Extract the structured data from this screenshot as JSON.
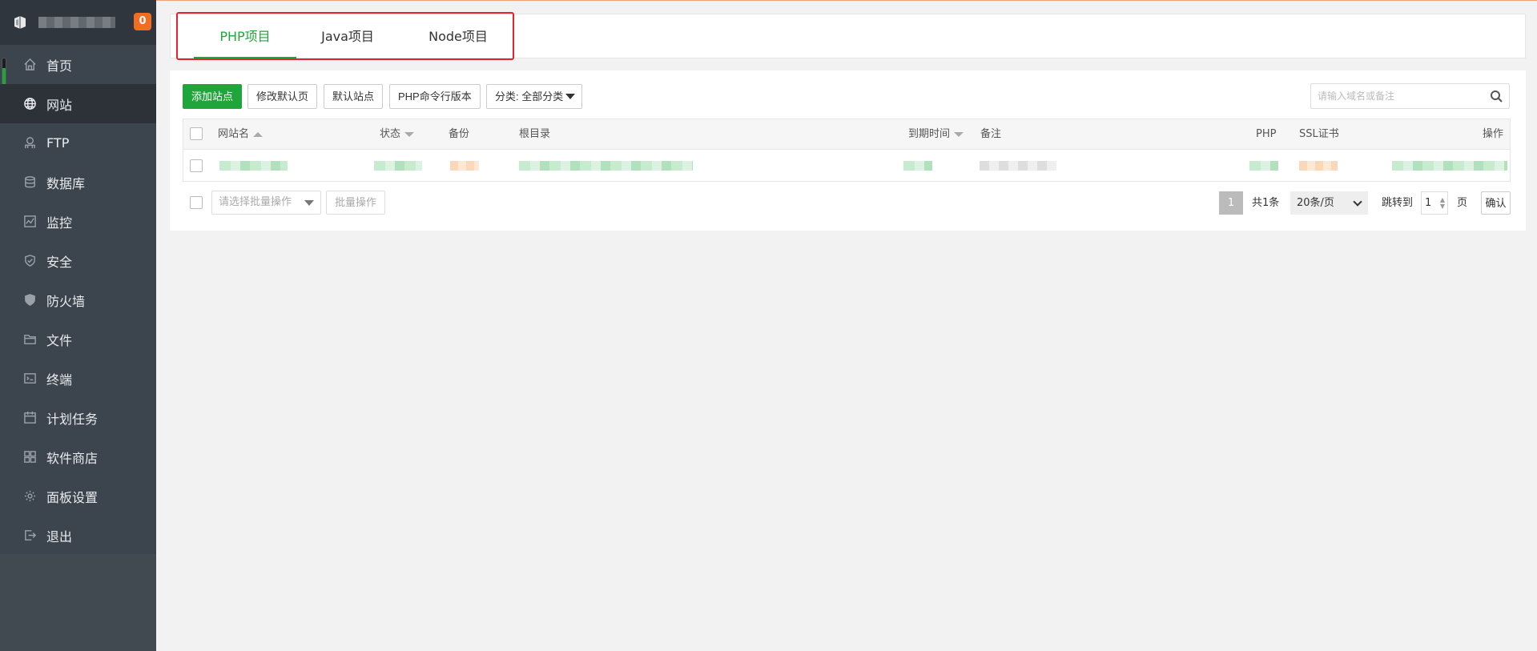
{
  "sidebar": {
    "badge": "0",
    "items": [
      {
        "label": "首页",
        "icon": "home-icon"
      },
      {
        "label": "网站",
        "icon": "globe-icon",
        "active": true
      },
      {
        "label": "FTP",
        "icon": "ftp-icon"
      },
      {
        "label": "数据库",
        "icon": "database-icon"
      },
      {
        "label": "监控",
        "icon": "monitor-icon"
      },
      {
        "label": "安全",
        "icon": "shield-icon"
      },
      {
        "label": "防火墙",
        "icon": "firewall-icon"
      },
      {
        "label": "文件",
        "icon": "folder-icon"
      },
      {
        "label": "终端",
        "icon": "terminal-icon"
      },
      {
        "label": "计划任务",
        "icon": "calendar-icon"
      },
      {
        "label": "软件商店",
        "icon": "apps-icon"
      },
      {
        "label": "面板设置",
        "icon": "gear-icon"
      },
      {
        "label": "退出",
        "icon": "logout-icon"
      }
    ]
  },
  "tabs": [
    {
      "label": "PHP项目",
      "active": true
    },
    {
      "label": "Java项目"
    },
    {
      "label": "Node项目"
    }
  ],
  "toolbar": {
    "add_site": "添加站点",
    "modify_default_page": "修改默认页",
    "default_site": "默认站点",
    "php_cli_version": "PHP命令行版本",
    "category": "分类: 全部分类"
  },
  "search": {
    "placeholder": "请输入域名或备注"
  },
  "table": {
    "columns": {
      "site_name": "网站名",
      "status": "状态",
      "backup": "备份",
      "root_dir": "根目录",
      "expire_time": "到期时间",
      "remark": "备注",
      "php": "PHP",
      "ssl": "SSL证书",
      "actions": "操作"
    }
  },
  "bulk": {
    "select_placeholder": "请选择批量操作",
    "batch_button": "批量操作"
  },
  "pagination": {
    "current_page": "1",
    "total": "共1条",
    "per_page": "20条/页",
    "jump_to": "跳转到",
    "jump_value": "1",
    "page_unit": "页",
    "confirm": "确认"
  },
  "colors": {
    "accent_green": "#20a53a",
    "sidebar_bg": "#3c444d",
    "badge_orange": "#f26d21",
    "highlight_red": "#e8212c"
  }
}
